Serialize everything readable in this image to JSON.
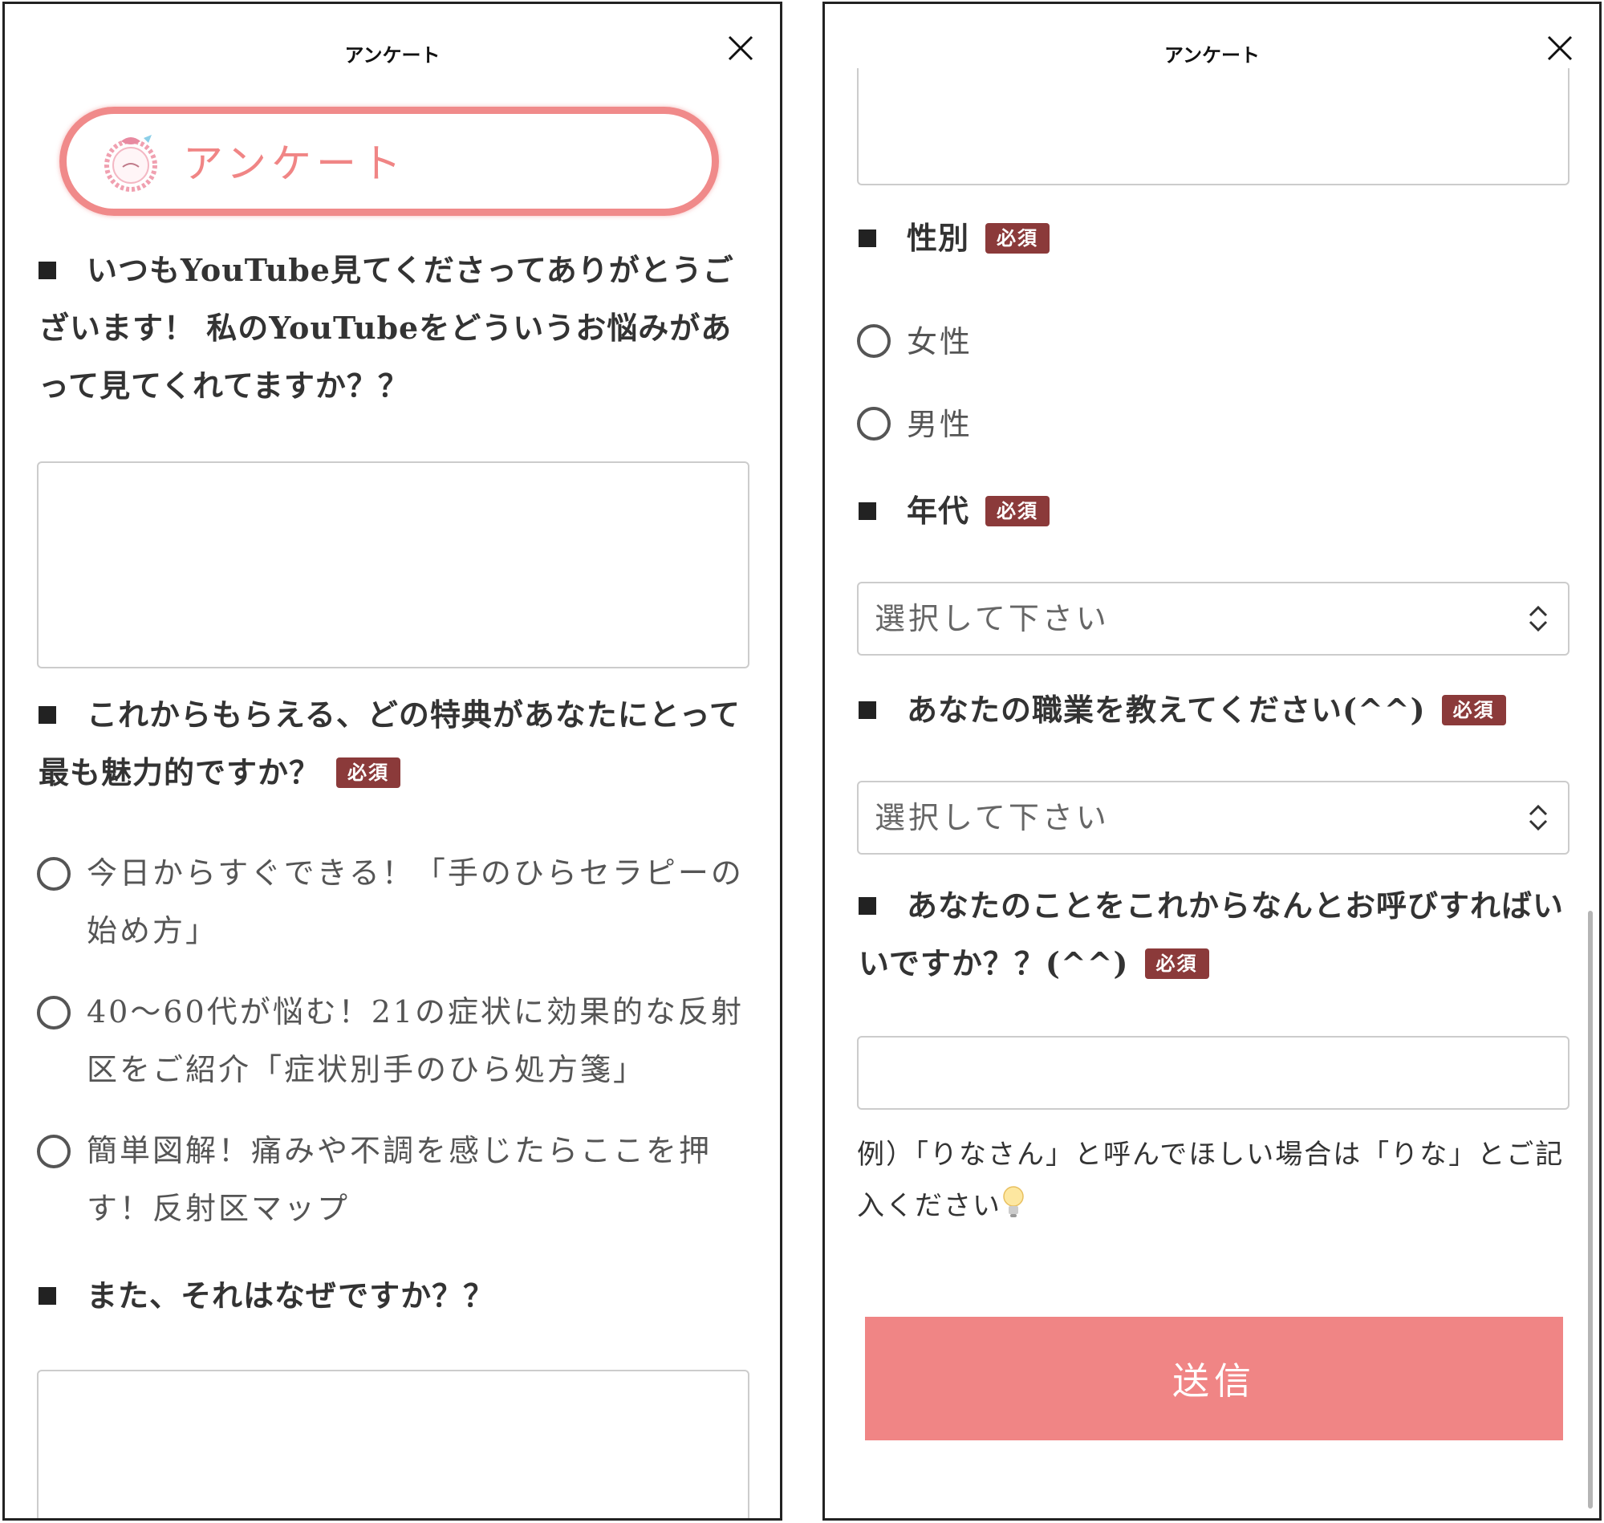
{
  "header": {
    "title": "アンケート"
  },
  "banner": {
    "title": "アンケート"
  },
  "left": {
    "q1": "いつもYouTube見てくださってありがとうございます！ 私のYouTubeをどういうお悩みがあって見てくれてますか？？",
    "q2": "これからもらえる、どの特典があなたにとって最も魅力的ですか？",
    "q2_required": "必須",
    "q2_options": [
      "今日からすぐできる！「手のひらセラピーの始め方」",
      "40〜60代が悩む！21の症状に効果的な反射区をご紹介「症状別手のひら処方箋」",
      "簡単図解！痛みや不調を感じたらここを押す！反射区マップ"
    ],
    "q3": "また、それはなぜですか？？"
  },
  "right": {
    "gender_label": "性別",
    "gender_required": "必須",
    "gender_options": [
      "女性",
      "男性"
    ],
    "age_label": "年代",
    "age_required": "必須",
    "age_select_value": "選択して下さい",
    "job_label": "あなたの職業を教えてください(^^)",
    "job_required": "必須",
    "job_select_value": "選択して下さい",
    "name_label": "あなたのことをこれからなんとお呼びすればいいですか？？(^^)",
    "name_required": "必須",
    "name_example": "例）「りなさん」と呼んでほしい場合は「りな」とご記入ください",
    "submit_label": "送信"
  },
  "colors": {
    "accent": "#f08585",
    "required_badge": "#8b3a3a",
    "border": "#cccccc"
  },
  "icons": [
    "close-icon",
    "chevron-up-down-icon",
    "lightbulb-icon",
    "wreath-logo-icon"
  ]
}
